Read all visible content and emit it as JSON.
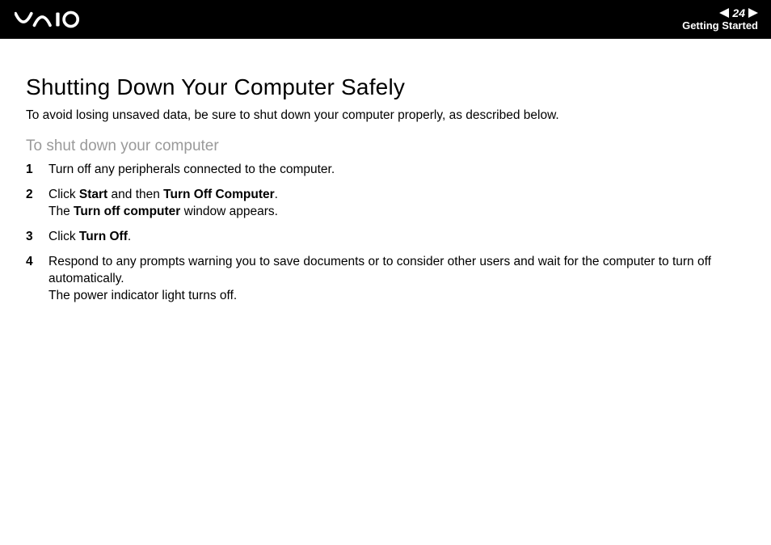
{
  "header": {
    "page_number": "24",
    "section": "Getting Started"
  },
  "page": {
    "title": "Shutting Down Your Computer Safely",
    "intro": "To avoid losing unsaved data, be sure to shut down your computer properly, as described below.",
    "subheading": "To shut down your computer",
    "steps": {
      "s1": "Turn off any peripherals connected to the computer.",
      "s2a": "Click ",
      "s2b": "Start",
      "s2c": " and then ",
      "s2d": "Turn Off Computer",
      "s2e": ".",
      "s2f": "The ",
      "s2g": "Turn off computer",
      "s2h": " window appears.",
      "s3a": "Click ",
      "s3b": "Turn Off",
      "s3c": ".",
      "s4a": "Respond to any prompts warning you to save documents or to consider other users and wait for the computer to turn off automatically.",
      "s4b": "The power indicator light turns off."
    }
  }
}
